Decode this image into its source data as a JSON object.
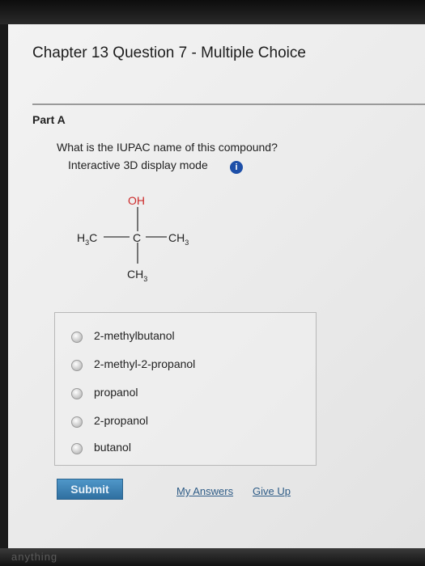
{
  "header": {
    "title": "Chapter 13 Question 7 - Multiple Choice"
  },
  "part": {
    "label": "Part A"
  },
  "question": {
    "text": "What is the IUPAC name of this compound?",
    "mode_text": "Interactive 3D display mode",
    "info_glyph": "i"
  },
  "molecule": {
    "top_group": "OH",
    "left_group": "H",
    "left_sub": "3",
    "left_tail": "C",
    "center_atom": "C",
    "right_group": "CH",
    "right_sub": "3",
    "bottom_group": "CH",
    "bottom_sub": "3"
  },
  "choices": [
    {
      "label": "2-methylbutanol"
    },
    {
      "label": "2-methyl-2-propanol"
    },
    {
      "label": "propanol"
    },
    {
      "label": "2-propanol"
    },
    {
      "label": "butanol"
    }
  ],
  "actions": {
    "submit_label": "Submit",
    "my_answers_label": "My Answers",
    "give_up_label": "Give Up"
  },
  "footer": {
    "partial_text": "anything"
  },
  "colors": {
    "oxygen_red": "#cc2a2a",
    "submit_blue": "#3c82b6",
    "link_blue": "#2d5b86",
    "info_blue": "#1d4fa8"
  }
}
